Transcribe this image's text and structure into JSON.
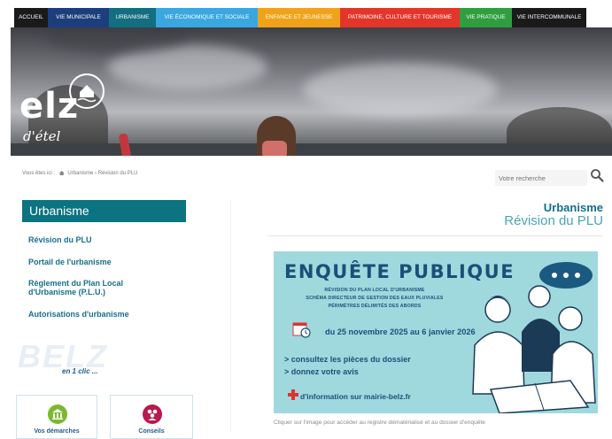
{
  "nav": [
    {
      "label": "ACCUEIL",
      "color": "#1a1a1a"
    },
    {
      "label": "VIE MUNICIPALE",
      "color": "#1d3e7c"
    },
    {
      "label": "URBANISME",
      "color": "#126e80"
    },
    {
      "label": "VIE ÉCONOMIQUE ET SOCIALE",
      "color": "#3aa7e0"
    },
    {
      "label": "ENFANCE ET JEUNESSE",
      "color": "#f0a31a"
    },
    {
      "label": "PATRIMOINE, CULTURE ET TOURISME",
      "color": "#e4352a"
    },
    {
      "label": "VIE PRATIQUE",
      "color": "#2f9e3f"
    },
    {
      "label": "VIE INTERCOMMUNALE",
      "color": "#1a1a1a"
    }
  ],
  "hero": {
    "logo_text": "elz",
    "logo_sub": "d'étel"
  },
  "breadcrumb": {
    "prefix": "Vous êtes ici :",
    "path": "Urbanisme › Révision du PLU"
  },
  "search": {
    "placeholder": "Votre recherche"
  },
  "sidebar": {
    "title": "Urbanisme",
    "links": [
      "Révision du PLU",
      "Portail de l'urbanisme",
      "Règlement du Plan Local d'Urbanisme (P.L.U.)",
      "Autorisations d'urbanisme"
    ],
    "watermark": "BELZ",
    "one_click": "en 1 clic ...",
    "tiles": [
      {
        "label": "Vos démarches",
        "icon": "building-icon",
        "color": "#7cb82f"
      },
      {
        "label": "Conseils",
        "icon": "people-icon",
        "color": "#b8184a"
      }
    ]
  },
  "main": {
    "title": "Urbanisme",
    "subtitle": "Révision du PLU",
    "banner": {
      "title": "ENQUÊTE PUBLIQUE",
      "lines": [
        "RÉVISION DU PLAN LOCAL D'URBANISME",
        "SCHÉMA DIRECTEUR DE GESTION DES EAUX PLUVIALES",
        "PÉRIMÈTRES DÉLIMITÉS DES ABORDS"
      ],
      "dates": "du 25 novembre 2025 au 6 janvier 2026",
      "bullets": [
        "> consultez les pièces du dossier",
        "> donnez votre avis"
      ],
      "info": "d'information sur mairie-belz.fr"
    },
    "caption": "Cliquer sur l'image pour accéder au registre dématérialisé et au dossier d'enquête"
  }
}
